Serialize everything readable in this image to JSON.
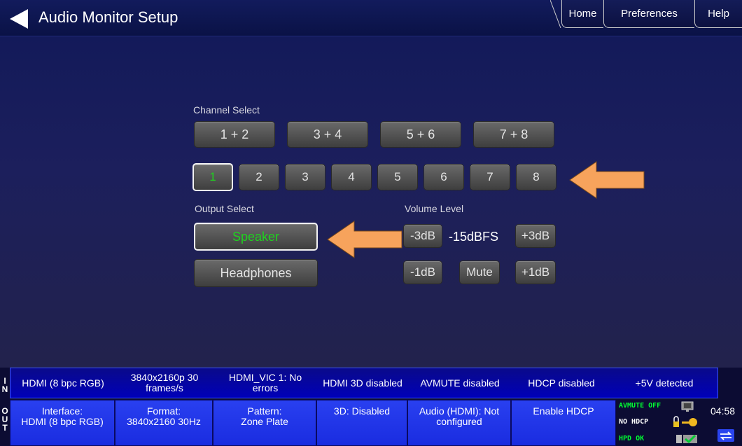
{
  "header": {
    "title": "Audio Monitor Setup",
    "nav": [
      "Home",
      "Preferences",
      "Help"
    ]
  },
  "channel_select": {
    "label": "Channel Select",
    "pairs": [
      "1 + 2",
      "3 + 4",
      "5 + 6",
      "7 + 8"
    ],
    "channels": [
      "1",
      "2",
      "3",
      "4",
      "5",
      "6",
      "7",
      "8"
    ],
    "selected_channel": "1"
  },
  "output_select": {
    "label": "Output Select",
    "options": [
      "Speaker",
      "Headphones"
    ],
    "selected": "Speaker"
  },
  "volume": {
    "label": "Volume Level",
    "minus3": "-3dB",
    "readout": "-15dBFS",
    "plus3": "+3dB",
    "minus1": "-1dB",
    "mute": "Mute",
    "plus1": "+1dB"
  },
  "status_in": {
    "side": [
      "I",
      "N"
    ],
    "cells": [
      "HDMI (8 bpc RGB)",
      "3840x2160p 30 frames/s",
      "HDMI_VIC 1: No errors",
      "HDMI 3D disabled",
      "AVMUTE disabled",
      "HDCP disabled",
      "+5V detected"
    ]
  },
  "status_out": {
    "side": [
      "O",
      "U",
      "T"
    ],
    "cells": [
      {
        "line1": "Interface:",
        "line2": "HDMI (8 bpc RGB)"
      },
      {
        "line1": "Format:",
        "line2": "3840x2160 30Hz"
      },
      {
        "line1": "Pattern:",
        "line2": "Zone Plate"
      },
      {
        "line1": "3D: Disabled",
        "line2": ""
      },
      {
        "line1": "Audio (HDMI): Not",
        "line2": "configured"
      },
      {
        "line1": "Enable HDCP",
        "line2": ""
      }
    ],
    "indicators": {
      "avmute": "AVMUTE OFF",
      "hdcp": "NO HDCP",
      "hpd": "HPD OK"
    },
    "clock": "04:58"
  },
  "colors": {
    "active_green": "#1fd21f",
    "arrow_orange": "#f7a35c",
    "status_blue": "#1a2ce0",
    "indicator_green": "#00ff33"
  }
}
